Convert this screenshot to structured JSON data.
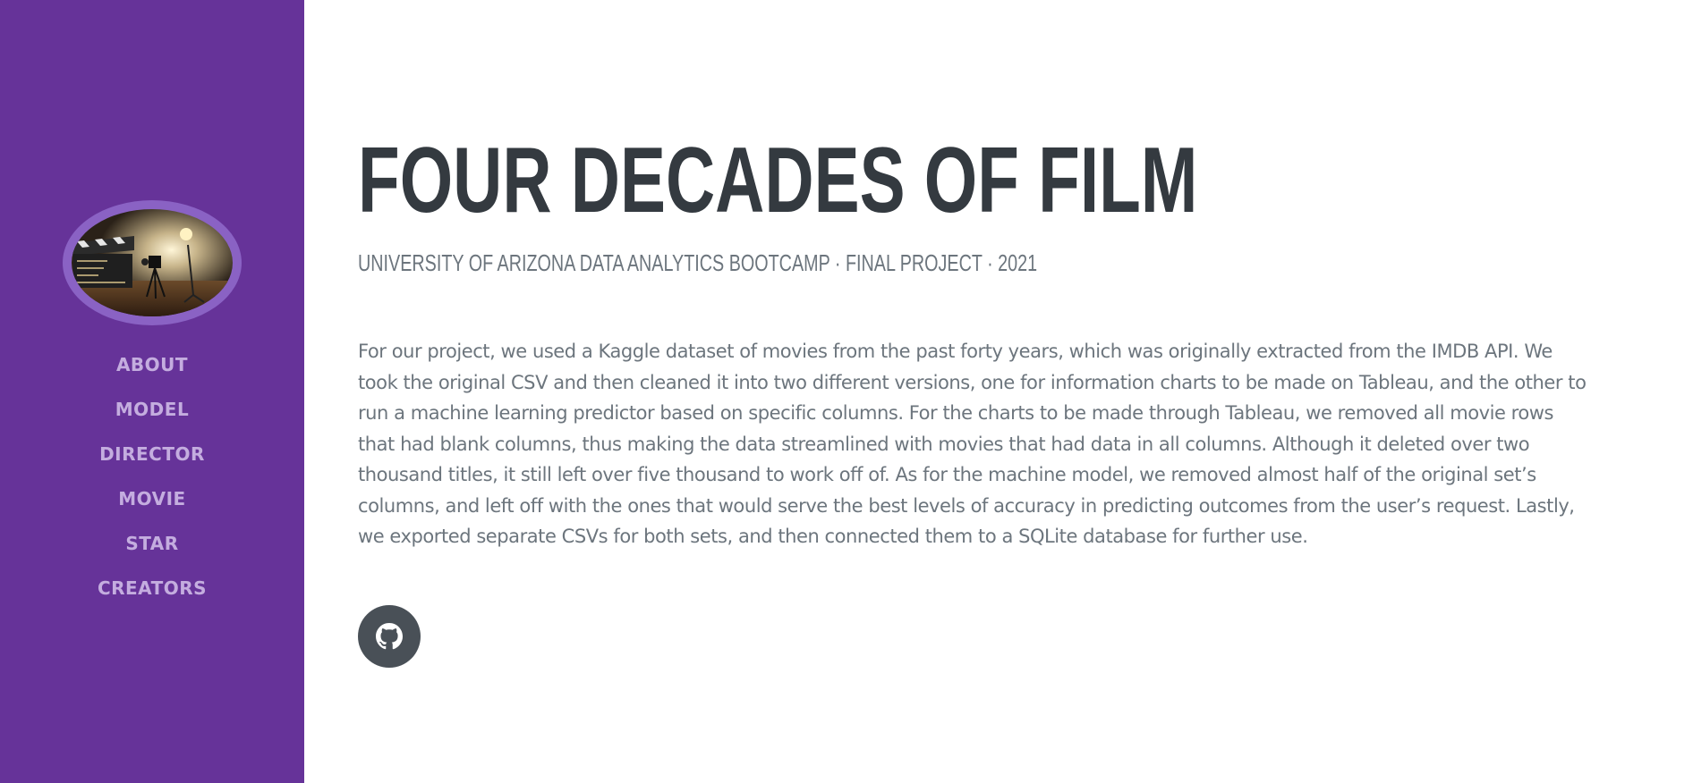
{
  "sidebar": {
    "nav_items": [
      {
        "label": "About"
      },
      {
        "label": "Model"
      },
      {
        "label": "Director"
      },
      {
        "label": "Movie"
      },
      {
        "label": "Star"
      },
      {
        "label": "Creators"
      }
    ]
  },
  "hero": {
    "title": "Four Decades of Film",
    "subtitle": "University of Arizona Data Analytics Bootcamp · Final Project · 2021",
    "description": "For our project, we used a Kaggle dataset of movies from the past forty years, which was originally extracted from the IMDB API. We took the original CSV and then cleaned it into two different versions, one for information charts to be made on Tableau, and the other to run a machine learning predictor based on specific columns. For the charts to be made through Tableau, we removed all movie rows that had blank columns, thus making the data streamlined with movies that had data in all columns. Although it deleted over two thousand titles, it still left over five thousand to work off of. As for the machine model, we removed almost half of the original set’s columns, and left off with the ones that would serve the best levels of accuracy in predicting outcomes from the user’s request. Lastly, we exported separate CSVs for both sets, and then connected them to a SQLite database for further use."
  },
  "social": {
    "github_icon": "github-icon"
  },
  "colors": {
    "sidebar_bg": "#663399",
    "nav_text": "#c4addf",
    "title_text": "#343a40",
    "body_text": "#6c757d",
    "social_button_bg": "#495057"
  }
}
